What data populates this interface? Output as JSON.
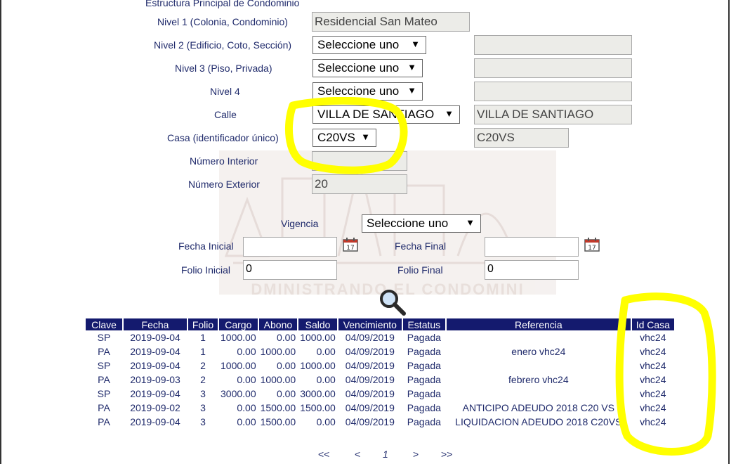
{
  "section_title": "Estructura Principal de Condominio",
  "fields": {
    "nivel1_label": "Nivel 1 (Colonia, Condominio)",
    "nivel1_value": "Residencial San Mateo",
    "nivel2_label": "Nivel 2 (Edificio, Coto, Sección)",
    "nivel2_select": "Seleccione uno",
    "nivel3_label": "Nivel 3 (Piso, Privada)",
    "nivel3_select": "Seleccione uno",
    "nivel4_label": "Nivel 4",
    "nivel4_select": "Seleccione uno",
    "calle_label": "Calle",
    "calle_select": "VILLA DE SANTIAGO",
    "calle_value": "VILLA DE SANTIAGO",
    "casa_label": "Casa (identificador único)",
    "casa_select": "C20VS",
    "casa_value": "C20VS",
    "num_interior_label": "Número Interior",
    "num_interior_value": "",
    "num_exterior_label": "Número Exterior",
    "num_exterior_value": "20"
  },
  "filters": {
    "vigencia_label": "Vigencia",
    "vigencia_select": "Seleccione uno",
    "fecha_inicial_label": "Fecha Inicial",
    "fecha_final_label": "Fecha Final",
    "folio_inicial_label": "Folio Inicial",
    "folio_inicial_value": "0",
    "folio_final_label": "Folio Final",
    "folio_final_value": "0"
  },
  "watermark_text": "DMINISTRANDO EL CONDOMINI",
  "table": {
    "headers": [
      "Clave",
      "Fecha",
      "Folio",
      "Cargo",
      "Abono",
      "Saldo",
      "Vencimiento",
      "Estatus",
      "Referencia",
      "Id Casa"
    ],
    "rows": [
      [
        "SP",
        "2019-09-04",
        "1",
        "1000.00",
        "0.00",
        "1000.00",
        "04/09/2019",
        "Pagada",
        "",
        "vhc24"
      ],
      [
        "PA",
        "2019-09-04",
        "1",
        "0.00",
        "1000.00",
        "0.00",
        "04/09/2019",
        "Pagada",
        "enero vhc24",
        "vhc24"
      ],
      [
        "SP",
        "2019-09-04",
        "2",
        "1000.00",
        "0.00",
        "1000.00",
        "04/09/2019",
        "Pagada",
        "",
        "vhc24"
      ],
      [
        "PA",
        "2019-09-03",
        "2",
        "0.00",
        "1000.00",
        "0.00",
        "04/09/2019",
        "Pagada",
        "febrero vhc24",
        "vhc24"
      ],
      [
        "SP",
        "2019-09-04",
        "3",
        "3000.00",
        "0.00",
        "3000.00",
        "04/09/2019",
        "Pagada",
        "",
        "vhc24"
      ],
      [
        "PA",
        "2019-09-02",
        "3",
        "0.00",
        "1500.00",
        "1500.00",
        "04/09/2019",
        "Pagada",
        "ANTICIPO ADEUDO 2018 C20 VS",
        "vhc24"
      ],
      [
        "PA",
        "2019-09-04",
        "3",
        "0.00",
        "1500.00",
        "0.00",
        "04/09/2019",
        "Pagada",
        "LIQUIDACION ADEUDO 2018 C20VS",
        "vhc24"
      ]
    ]
  },
  "pager": {
    "first": "<<",
    "prev": "<",
    "current": "1",
    "next": ">",
    "last": ">>"
  },
  "colors": {
    "header_bg": "#141a6e",
    "label": "#1f2a6b",
    "highlight": "#ffff00"
  }
}
